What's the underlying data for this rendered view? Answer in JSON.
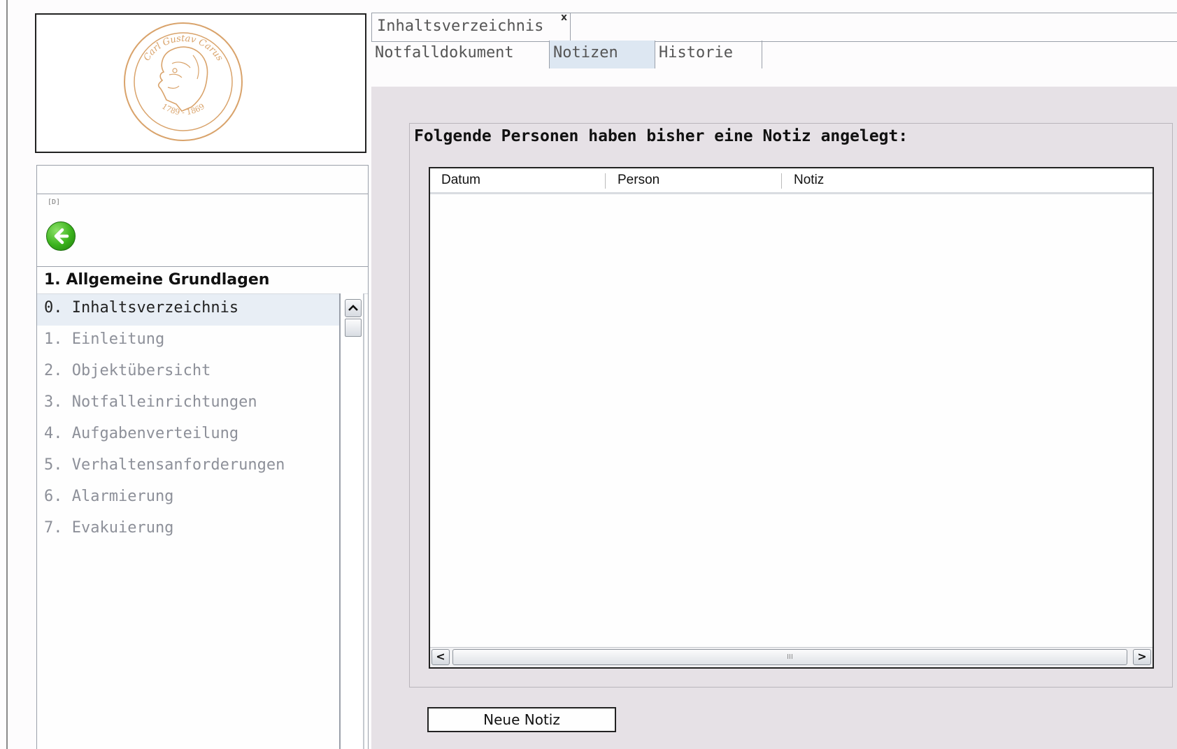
{
  "logo": {
    "text_top": "Carl Gustav Carus",
    "text_bottom": "1789 - 1869",
    "color": "#d9a36b"
  },
  "sidebar": {
    "tiny_label": "[D]",
    "back_icon": "back-arrow-icon",
    "section_title": "1. Allgemeine Grundlagen",
    "items": [
      {
        "label": "0. Inhaltsverzeichnis",
        "active": true
      },
      {
        "label": "1. Einleitung"
      },
      {
        "label": "2. Objektübersicht"
      },
      {
        "label": "3. Notfalleinrichtungen"
      },
      {
        "label": "4. Aufgabenverteilung"
      },
      {
        "label": "5. Verhaltensanforderungen"
      },
      {
        "label": "6. Alarmierung"
      },
      {
        "label": "7. Evakuierung"
      }
    ]
  },
  "tabs": {
    "document_tab": "Inhaltsverzeichnis",
    "close_symbol": "x",
    "subtabs": [
      "Notfalldokument",
      "Notizen",
      "Historie"
    ],
    "active_subtab": "Notizen"
  },
  "notes": {
    "title": "Folgende Personen haben bisher eine Notiz angelegt:",
    "columns": [
      "Datum",
      "Person",
      "Notiz"
    ],
    "rows": [],
    "scroll_thumb_glyph": "III",
    "scroll_left": "<",
    "scroll_right": ">",
    "new_note_button": "Neue Notiz"
  },
  "colors": {
    "panel_bg": "#e6e1e6",
    "active_tab_bg": "#dde7f2",
    "inactive_item_text": "#8d9099"
  }
}
